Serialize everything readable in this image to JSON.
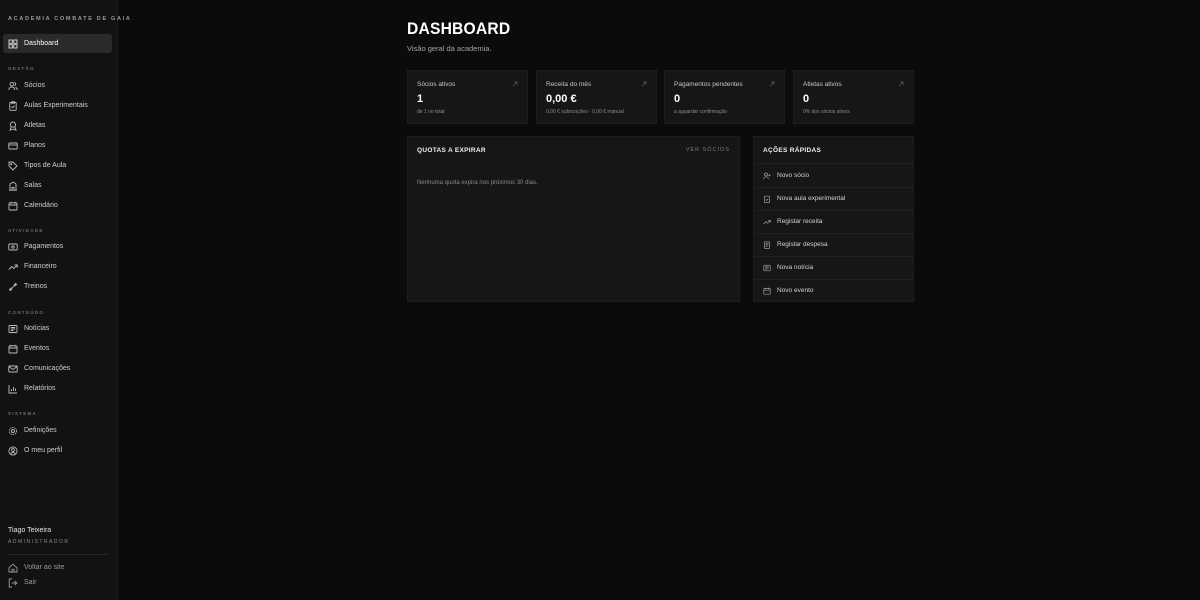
{
  "sidebar": {
    "brand": "ACADEMIA COMBATE DE GAIA",
    "dashboard": "Dashboard",
    "sections": {
      "gestao": "GESTÃO",
      "atividade": "ATIVIDADE",
      "conteudo": "CONTEÚDO",
      "sistema": "SISTEMA"
    },
    "items": {
      "socios": "Sócios",
      "aulas_experimentais": "Aulas Experimentais",
      "atletas": "Atletas",
      "planos": "Planos",
      "tipos_de_aula": "Tipos de Aula",
      "salas": "Salas",
      "calendario": "Calendário",
      "pagamentos": "Pagamentos",
      "financeiro": "Financeiro",
      "treinos": "Treinos",
      "noticias": "Notícias",
      "eventos": "Eventos",
      "comunicacoes": "Comunicações",
      "relatorios": "Relatórios",
      "definicoes": "Definições",
      "o_meu_perfil": "O meu perfil"
    },
    "user": {
      "name": "Tiago Teixeira",
      "role": "ADMINISTRADOR"
    },
    "footer": {
      "voltar": "Voltar ao site",
      "sair": "Sair"
    }
  },
  "main": {
    "title": "DASHBOARD",
    "subtitle": "Visão geral da academia.",
    "stats": {
      "socios": {
        "label": "Sócios ativos",
        "value": "1",
        "sub": "de 1 no total"
      },
      "receita": {
        "label": "Receita do mês",
        "value": "0,00 €",
        "sub": "0,00 € subscrições · 0,00 € manual"
      },
      "pagamentos": {
        "label": "Pagamentos pendentes",
        "value": "0",
        "sub": "a aguardar confirmação"
      },
      "atletas": {
        "label": "Atletas ativos",
        "value": "0",
        "sub": "0% dos sócios ativos"
      }
    },
    "quotas": {
      "title": "QUOTAS A EXPIRAR",
      "link": "VER SÓCIOS",
      "empty": "Nenhuma quota expira nos próximos 30 dias."
    },
    "actions": {
      "title": "AÇÕES RÁPIDAS",
      "novo_socio": "Novo sócio",
      "nova_aula": "Nova aula experimental",
      "registar_receita": "Registar receita",
      "registar_despesa": "Registar despesa",
      "nova_noticia": "Nova notícia",
      "novo_evento": "Novo evento"
    }
  },
  "colors": {
    "background": "#0b0b0b",
    "sidebar": "#121212",
    "card": "#161616",
    "active_item": "#2a2a2a",
    "text": "#ffffff",
    "muted": "#8a8a8a"
  }
}
